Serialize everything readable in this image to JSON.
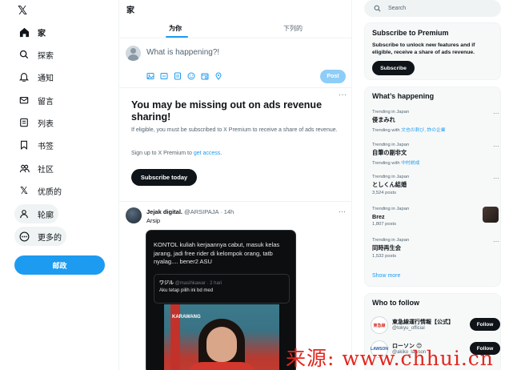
{
  "nav": {
    "logo": "𝕏",
    "items": [
      {
        "label": "家",
        "icon": "home-icon"
      },
      {
        "label": "探索",
        "icon": "search-icon"
      },
      {
        "label": "通知",
        "icon": "bell-icon"
      },
      {
        "label": "留言",
        "icon": "mail-icon"
      },
      {
        "label": "列表",
        "icon": "list-icon"
      },
      {
        "label": "书签",
        "icon": "bookmark-icon"
      },
      {
        "label": "社区",
        "icon": "people-icon"
      },
      {
        "label": "优质的",
        "icon": "x-logo-icon"
      },
      {
        "label": "轮廓",
        "icon": "person-icon"
      },
      {
        "label": "更多的",
        "icon": "more-circle-icon"
      }
    ],
    "post_button": "邮政"
  },
  "main": {
    "title": "家",
    "tabs": [
      {
        "label": "为你",
        "active": true
      },
      {
        "label": "下列的",
        "active": false
      }
    ],
    "composer": {
      "placeholder": "What is happening?!",
      "post_button": "Post",
      "tools": [
        "image-icon",
        "gif-icon",
        "list-icon",
        "emoji-icon",
        "schedule-icon",
        "location-icon"
      ]
    },
    "promo": {
      "dots": "···",
      "title": "You may be missing out on ads revenue sharing!",
      "body": "If eligible, you must be subscribed to X Premium to receive a share of ads revenue.",
      "link_prefix": "Sign up to X Premium to ",
      "link_text": "get access",
      "link_suffix": ".",
      "button": "Subscribe today"
    },
    "tweet": {
      "name": "Jejak digital.",
      "handle": "@ARSIPAJA",
      "time": "· 14h",
      "dots": "···",
      "text": "Arsip",
      "media_text": "KONTOL kuliah kerjaannya cabut, masuk kelas jarang, jadi free rider di kelompok orang, tatb nyalag.... bener2 ASU",
      "quote_name": "ワジル",
      "quote_handle": "@masihkawar · 2 hari",
      "quote_text": "Aku tetap pilih ini bd med",
      "banner_text": "KARAWANG"
    }
  },
  "right": {
    "search_placeholder": "Search",
    "premium": {
      "title": "Subscribe to Premium",
      "body": "Subscribe to unlock new features and if eligible, receive a share of ads revenue.",
      "button": "Subscribe"
    },
    "happening": {
      "title": "What’s happening",
      "trends": [
        {
          "meta": "Trending in Japan",
          "name": "侵まみれ",
          "with_prefix": "Trending with ",
          "with_links": "文也の刺び, 詐の企業"
        },
        {
          "meta": "Trending in Japan",
          "name": "自筆の副非文",
          "with_prefix": "Trending with ",
          "with_links": "中村説成"
        },
        {
          "meta": "Trending in Japan",
          "name": "としくん結婚",
          "count": "3,524 posts"
        },
        {
          "meta": "Trending in Japan",
          "name": "Brez",
          "count": "1,807 posts"
        },
        {
          "meta": "Trending in Japan",
          "name": "同時再生会",
          "count": "1,532 posts"
        }
      ],
      "show_more": "Show more"
    },
    "follow": {
      "title": "Who to follow",
      "users": [
        {
          "name": "東急線運行情報【公式】",
          "handle": "@tokyu_official",
          "avatar_text": "東急線",
          "button": "Follow"
        },
        {
          "name": "ローソン 😊",
          "handle": "@akiko_lawson",
          "avatar_text": "LAWSON",
          "button": "Follow"
        }
      ]
    }
  },
  "watermark": "来源: www.chhui.cn",
  "colors": {
    "accent": "#1d9bf0",
    "text": "#0f1419",
    "muted": "#536471",
    "watermark": "#e2261d"
  }
}
